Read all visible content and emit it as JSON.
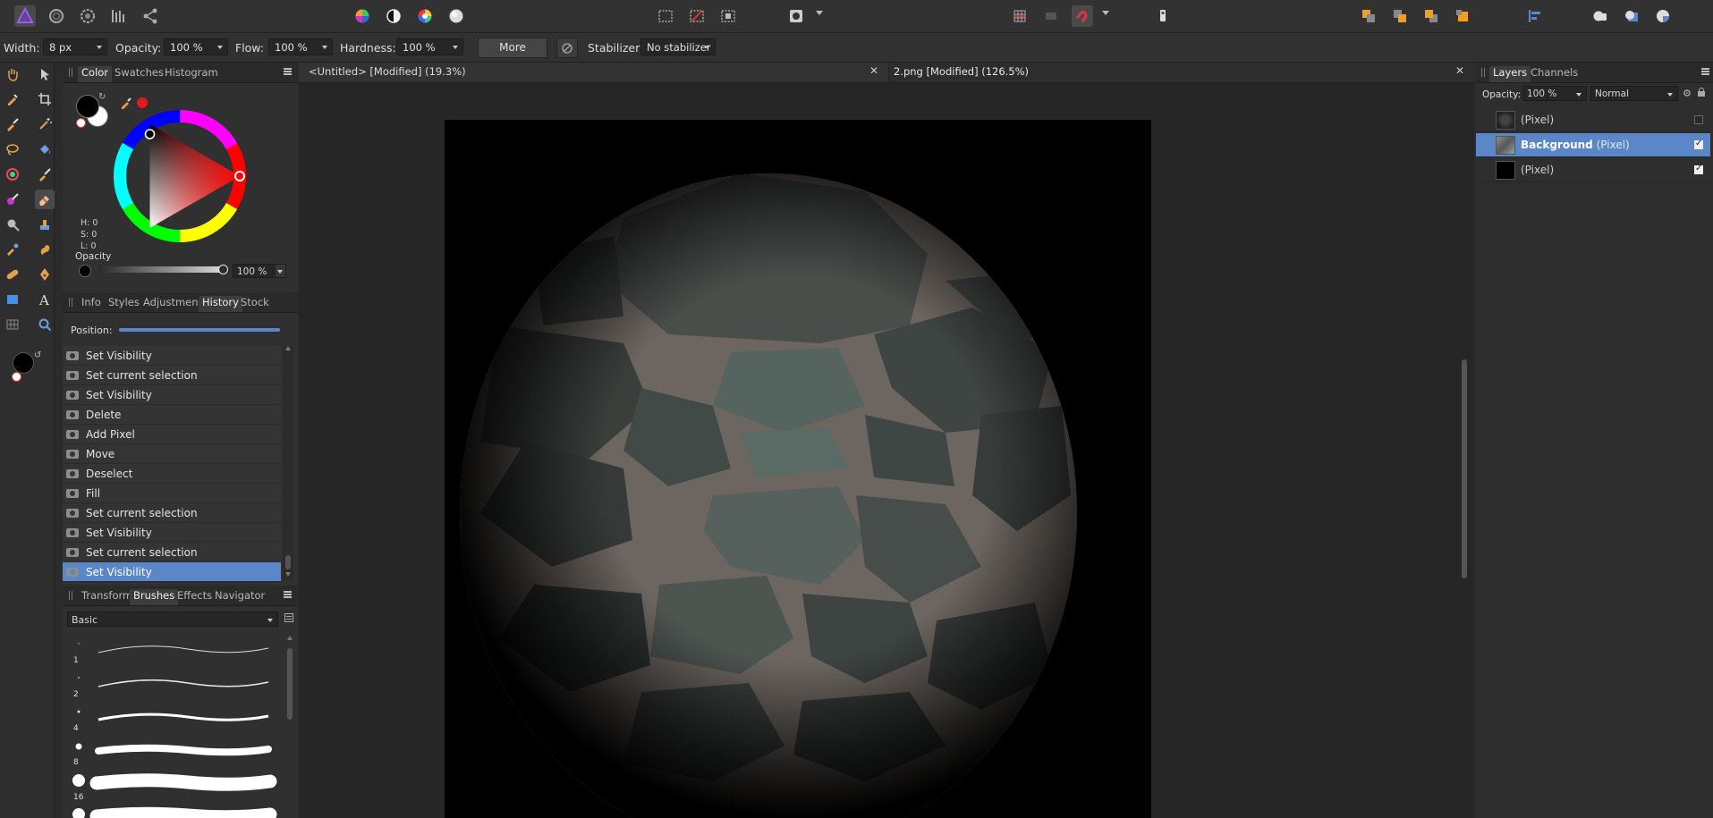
{
  "context_bar": {
    "width_label": "Width:",
    "width_value": "8 px",
    "opacity_label": "Opacity:",
    "opacity_value": "100 %",
    "flow_label": "Flow:",
    "flow_value": "100 %",
    "hardness_label": "Hardness:",
    "hardness_value": "100 %",
    "more_label": "More",
    "stabilizer_label": "Stabilizer:",
    "stabilizer_value": "No stabilizer"
  },
  "color_panel": {
    "tabs": [
      "Color",
      "Swatches",
      "Histogram"
    ],
    "active_tab": "Color",
    "h_label": "H: 0",
    "s_label": "S: 0",
    "l_label": "L: 0",
    "opacity_label": "Opacity",
    "opacity_value": "100 %",
    "primary_color": "#000000",
    "secondary_color": "#ffffff",
    "accent_color": "#e01b1b"
  },
  "history_panel": {
    "tabs": [
      "Info",
      "Styles",
      "Adjustment",
      "History",
      "Stock"
    ],
    "active_tab": "History",
    "position_label": "Position:",
    "position_value": 1.0,
    "items": [
      "Set Visibility",
      "Set current selection",
      "Set Visibility",
      "Delete",
      "Add Pixel",
      "Move",
      "Deselect",
      "Fill",
      "Set current selection",
      "Set Visibility",
      "Set current selection",
      "Set Visibility"
    ],
    "selected_index": 11
  },
  "brushes_panel": {
    "tabs": [
      "Transform",
      "Brushes",
      "Effects",
      "Navigator"
    ],
    "active_tab": "Brushes",
    "category": "Basic",
    "sizes": [
      "1",
      "2",
      "4",
      "8",
      "16"
    ]
  },
  "documents": {
    "tabs": [
      {
        "label": "<Untitled> [Modified] (19.3%)"
      },
      {
        "label": "2.png [Modified] (126.5%)"
      }
    ],
    "close_glyph": "✕"
  },
  "layers_panel": {
    "tabs": [
      "Layers",
      "Channels"
    ],
    "active_tab": "Layers",
    "opacity_label": "Opacity:",
    "opacity_value": "100 %",
    "blend_mode": "Normal",
    "layers": [
      {
        "name": "",
        "type": "(Pixel)",
        "visible": false
      },
      {
        "name": "Background",
        "type": "(Pixel)",
        "visible": true
      },
      {
        "name": "",
        "type": "(Pixel)",
        "visible": true
      }
    ],
    "selected_index": 1
  },
  "colors": {
    "selection_blue": "#5b87c9",
    "persona_purple": "#7b3fc9"
  }
}
